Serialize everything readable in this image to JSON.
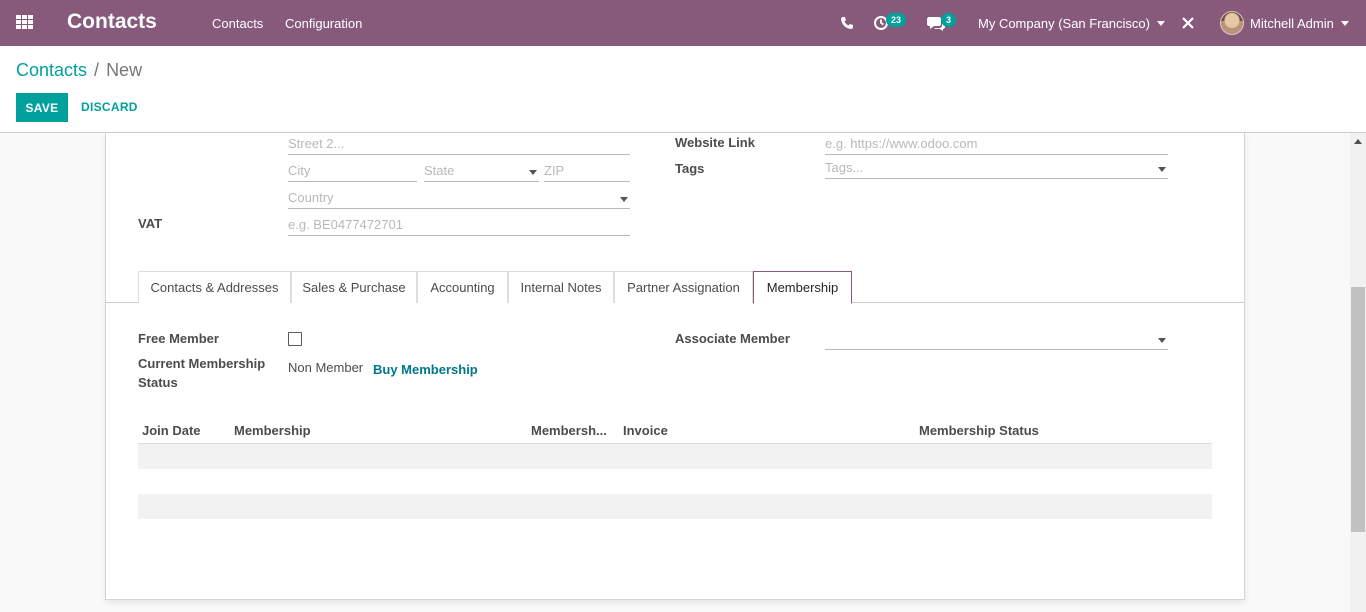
{
  "navbar": {
    "app_title": "Contacts",
    "menu": [
      "Contacts",
      "Configuration"
    ],
    "activity_count": "23",
    "messages_count": "3",
    "company": "My Company (San Francisco)",
    "user": "Mitchell Admin",
    "brand_color": "#875a7b"
  },
  "breadcrumb": {
    "parent": "Contacts",
    "separator": "/",
    "current": "New"
  },
  "buttons": {
    "save": "SAVE",
    "discard": "DISCARD",
    "accent_color": "#00a09d"
  },
  "address": {
    "street2_placeholder": "Street 2...",
    "city_placeholder": "City",
    "state_placeholder": "State",
    "zip_placeholder": "ZIP",
    "country_placeholder": "Country"
  },
  "vat": {
    "label": "VAT",
    "placeholder": "e.g. BE0477472701"
  },
  "website": {
    "label": "Website Link",
    "placeholder": "e.g. https://www.odoo.com"
  },
  "tags": {
    "label": "Tags",
    "placeholder": "Tags..."
  },
  "tabs": [
    {
      "label": "Contacts & Addresses",
      "active": false
    },
    {
      "label": "Sales & Purchase",
      "active": false
    },
    {
      "label": "Accounting",
      "active": false
    },
    {
      "label": "Internal Notes",
      "active": false
    },
    {
      "label": "Partner Assignation",
      "active": false
    },
    {
      "label": "Membership",
      "active": true
    }
  ],
  "membership": {
    "free_member_label": "Free Member",
    "free_member_checked": false,
    "status_label_line1": "Current Membership",
    "status_label_line2": "Status",
    "status_value": "Non Member",
    "buy_link": "Buy Membership",
    "associate_label": "Associate Member",
    "associate_value": ""
  },
  "membership_table": {
    "columns": [
      "Join Date",
      "Membership",
      "Membersh...",
      "Invoice",
      "Membership Status"
    ],
    "rows": []
  }
}
